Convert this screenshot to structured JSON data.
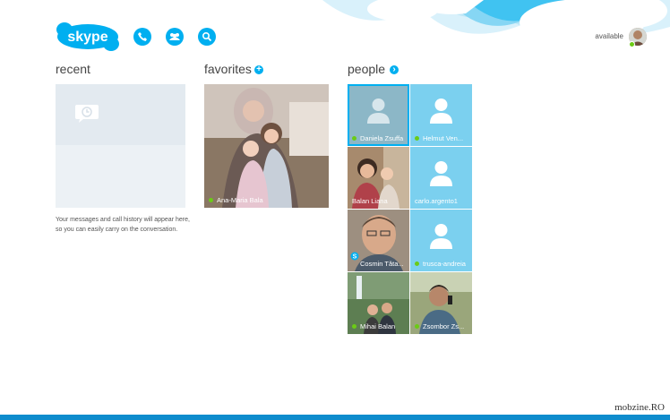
{
  "app": {
    "logo_text": "skype"
  },
  "header": {
    "status_text": "available",
    "icons": [
      "call-icon",
      "contacts-icon",
      "search-icon"
    ]
  },
  "sections": {
    "recent": {
      "title": "recent",
      "empty_message": "Your messages and call history will appear here, so you can easily carry on the conversation."
    },
    "favorites": {
      "title": "favorites",
      "items": [
        {
          "name": "Ana-Maria Bala",
          "online": true
        }
      ]
    },
    "people": {
      "title": "people",
      "items": [
        {
          "name": "Daniela Zsuffa",
          "online": true,
          "photo": false,
          "selected": true
        },
        {
          "name": "Helmut Ven...",
          "online": true,
          "photo": false
        },
        {
          "name": "Balan Liana",
          "online": false,
          "photo": true
        },
        {
          "name": "carlo.argento1",
          "online": false,
          "photo": false
        },
        {
          "name": "Cosmin Tăta...",
          "online": false,
          "photo": true,
          "badge": "skype"
        },
        {
          "name": "trusca-andreia",
          "online": true,
          "photo": false
        },
        {
          "name": "Mihai Balan",
          "online": true,
          "photo": true
        },
        {
          "name": "Zsombor Zs...",
          "online": true,
          "photo": true
        }
      ]
    }
  },
  "footer": {
    "more_label": "...",
    "watermark": "mobzine.RO"
  },
  "colors": {
    "accent": "#00aff0",
    "online": "#6bcb16",
    "bottom_bar": "#0e8ccd"
  }
}
